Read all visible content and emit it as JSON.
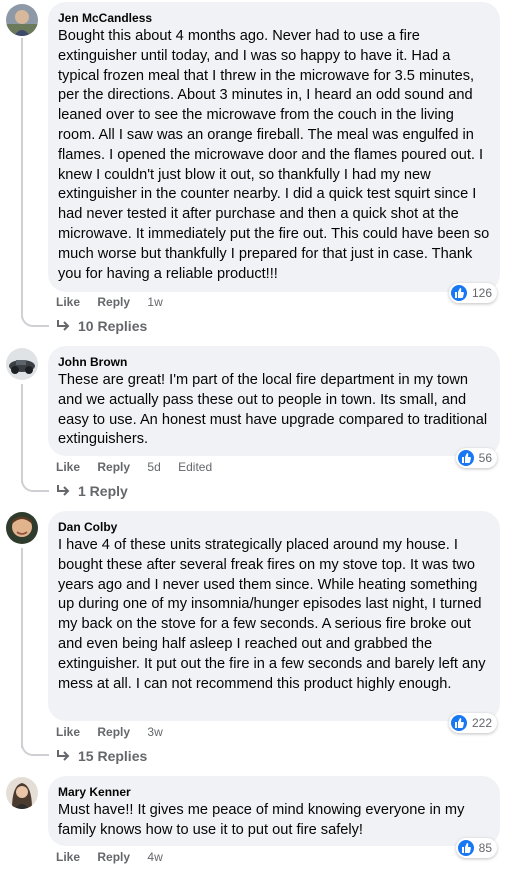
{
  "comments": [
    {
      "author": "Jen McCandless",
      "text": "Bought this about 4 months ago. Never had to use a fire extinguisher until today, and I was so happy to have it. Had a typical frozen meal that I threw in the microwave for 3.5 minutes, per the directions. About 3 minutes in, I heard an odd sound and leaned over to see the microwave from the couch in the living room. All I saw was an orange fireball. The meal was engulfed in flames. I opened the microwave door and the flames poured out. I knew I couldn't just blow it out, so thankfully I had my new extinguisher in the counter nearby. I did a quick test squirt since I had never tested it after purchase and then a quick shot at the microwave. It immediately put the fire out. This could have been so much worse but thankfully I prepared for that just in case. Thank you for having a reliable product!!!",
      "like_label": "Like",
      "reply_label": "Reply",
      "time": "1w",
      "reactions": "126",
      "replies": "10 Replies"
    },
    {
      "author": "John Brown",
      "text": "These are great! I'm part of the local fire department in my town and we actually pass these out to people in town. Its small, and easy to use. An honest must have upgrade compared to traditional extinguishers.",
      "like_label": "Like",
      "reply_label": "Reply",
      "time": "5d",
      "edited": "Edited",
      "reactions": "56",
      "replies": "1 Reply"
    },
    {
      "author": "Dan Colby",
      "text": "I have 4 of these units strategically placed around my house. I bought these after several freak fires on my stove top. It was two years ago and I never used them since. While heating something up during one of my insomnia/hunger episodes last night, I turned my back on the stove for a few seconds. A serious fire broke out and even being half asleep I reached out and grabbed the extinguisher. It put out the fire in a few seconds and barely left any mess at all. I can not recommend this product highly enough.",
      "like_label": "Like",
      "reply_label": "Reply",
      "time": "3w",
      "reactions": "222",
      "replies": "15 Replies"
    },
    {
      "author": "Mary Kenner",
      "text": "Must have!! It gives me peace of mind knowing everyone in my family knows how to use it to put out fire safely!",
      "like_label": "Like",
      "reply_label": "Reply",
      "time": "4w",
      "reactions": "85"
    }
  ],
  "colors": {
    "bubble": "#f0f2f5",
    "like_blue": "#1877f2",
    "meta_gray": "#65676b"
  },
  "icons": {
    "reaction": "thumbs-up-icon",
    "replies": "reply-arrow-icon"
  }
}
